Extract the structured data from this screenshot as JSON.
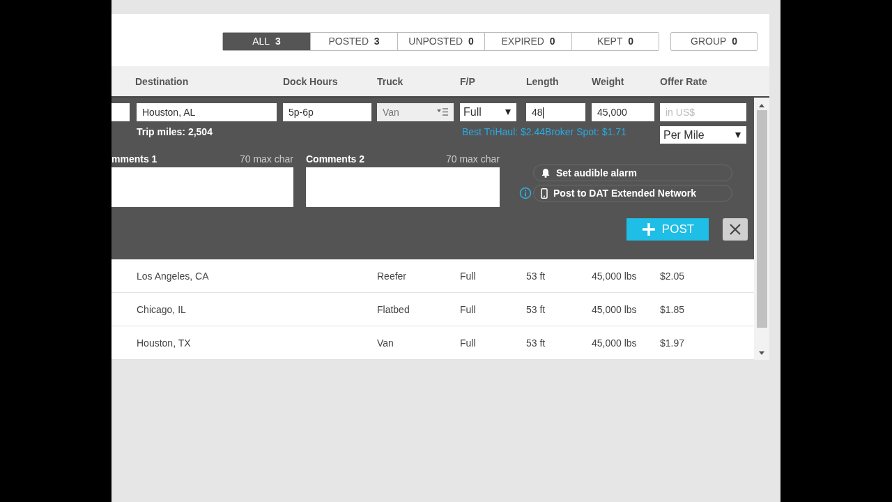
{
  "tabs": [
    {
      "label": "ALL",
      "count": "3",
      "selected": true
    },
    {
      "label": "POSTED",
      "count": "3",
      "selected": false
    },
    {
      "label": "UNPOSTED",
      "count": "0",
      "selected": false
    },
    {
      "label": "EXPIRED",
      "count": "0",
      "selected": false
    },
    {
      "label": "KEPT",
      "count": "0",
      "selected": false
    }
  ],
  "group_button": {
    "label": "GROUP",
    "count": "0"
  },
  "columns": [
    "Destination",
    "Dock Hours",
    "Truck",
    "F/P",
    "Length",
    "Weight",
    "Offer Rate"
  ],
  "form": {
    "destination": "Houston, AL",
    "dock_hours": "5p-6p",
    "truck": "Van",
    "fp": "Full",
    "length": "48",
    "weight": "45,000",
    "offer_rate": {
      "placeholder": "in US$"
    },
    "trip_miles": "Trip miles: 2,504",
    "rate_hint": "Best TriHaul: $2.44Broker Spot: $1.71",
    "rate_unit": "Per Mile",
    "comments": [
      {
        "label": "mments 1",
        "limit": "70 max char"
      },
      {
        "label": "Comments 2",
        "limit": "70 max char"
      }
    ],
    "options": [
      {
        "label": "Set audible alarm",
        "kind": "alarm"
      },
      {
        "label": "Post to DAT Extended Network",
        "kind": "network"
      }
    ],
    "post_button": "POST"
  },
  "rows": [
    {
      "destination": "Los Angeles, CA",
      "truck": "Reefer",
      "fp": "Full",
      "length": "53 ft",
      "weight": "45,000 lbs",
      "rate": "$2.05"
    },
    {
      "destination": "Chicago, IL",
      "truck": "Flatbed",
      "fp": "Full",
      "length": "53 ft",
      "weight": "45,000 lbs",
      "rate": "$1.85"
    },
    {
      "destination": "Houston, TX",
      "truck": "Van",
      "fp": "Full",
      "length": "53 ft",
      "weight": "45,000 lbs",
      "rate": "$1.97"
    }
  ]
}
